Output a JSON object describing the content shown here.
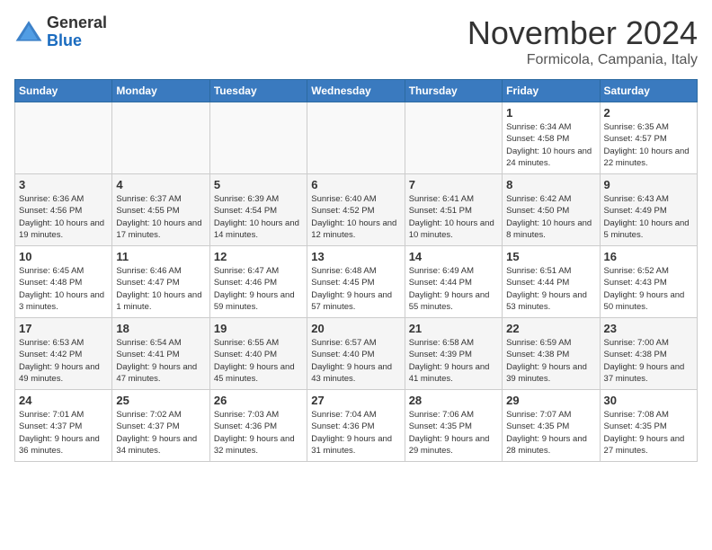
{
  "logo": {
    "general": "General",
    "blue": "Blue"
  },
  "title": "November 2024",
  "location": "Formicola, Campania, Italy",
  "days_of_week": [
    "Sunday",
    "Monday",
    "Tuesday",
    "Wednesday",
    "Thursday",
    "Friday",
    "Saturday"
  ],
  "weeks": [
    [
      {
        "day": "",
        "info": ""
      },
      {
        "day": "",
        "info": ""
      },
      {
        "day": "",
        "info": ""
      },
      {
        "day": "",
        "info": ""
      },
      {
        "day": "",
        "info": ""
      },
      {
        "day": "1",
        "info": "Sunrise: 6:34 AM\nSunset: 4:58 PM\nDaylight: 10 hours and 24 minutes."
      },
      {
        "day": "2",
        "info": "Sunrise: 6:35 AM\nSunset: 4:57 PM\nDaylight: 10 hours and 22 minutes."
      }
    ],
    [
      {
        "day": "3",
        "info": "Sunrise: 6:36 AM\nSunset: 4:56 PM\nDaylight: 10 hours and 19 minutes."
      },
      {
        "day": "4",
        "info": "Sunrise: 6:37 AM\nSunset: 4:55 PM\nDaylight: 10 hours and 17 minutes."
      },
      {
        "day": "5",
        "info": "Sunrise: 6:39 AM\nSunset: 4:54 PM\nDaylight: 10 hours and 14 minutes."
      },
      {
        "day": "6",
        "info": "Sunrise: 6:40 AM\nSunset: 4:52 PM\nDaylight: 10 hours and 12 minutes."
      },
      {
        "day": "7",
        "info": "Sunrise: 6:41 AM\nSunset: 4:51 PM\nDaylight: 10 hours and 10 minutes."
      },
      {
        "day": "8",
        "info": "Sunrise: 6:42 AM\nSunset: 4:50 PM\nDaylight: 10 hours and 8 minutes."
      },
      {
        "day": "9",
        "info": "Sunrise: 6:43 AM\nSunset: 4:49 PM\nDaylight: 10 hours and 5 minutes."
      }
    ],
    [
      {
        "day": "10",
        "info": "Sunrise: 6:45 AM\nSunset: 4:48 PM\nDaylight: 10 hours and 3 minutes."
      },
      {
        "day": "11",
        "info": "Sunrise: 6:46 AM\nSunset: 4:47 PM\nDaylight: 10 hours and 1 minute."
      },
      {
        "day": "12",
        "info": "Sunrise: 6:47 AM\nSunset: 4:46 PM\nDaylight: 9 hours and 59 minutes."
      },
      {
        "day": "13",
        "info": "Sunrise: 6:48 AM\nSunset: 4:45 PM\nDaylight: 9 hours and 57 minutes."
      },
      {
        "day": "14",
        "info": "Sunrise: 6:49 AM\nSunset: 4:44 PM\nDaylight: 9 hours and 55 minutes."
      },
      {
        "day": "15",
        "info": "Sunrise: 6:51 AM\nSunset: 4:44 PM\nDaylight: 9 hours and 53 minutes."
      },
      {
        "day": "16",
        "info": "Sunrise: 6:52 AM\nSunset: 4:43 PM\nDaylight: 9 hours and 50 minutes."
      }
    ],
    [
      {
        "day": "17",
        "info": "Sunrise: 6:53 AM\nSunset: 4:42 PM\nDaylight: 9 hours and 49 minutes."
      },
      {
        "day": "18",
        "info": "Sunrise: 6:54 AM\nSunset: 4:41 PM\nDaylight: 9 hours and 47 minutes."
      },
      {
        "day": "19",
        "info": "Sunrise: 6:55 AM\nSunset: 4:40 PM\nDaylight: 9 hours and 45 minutes."
      },
      {
        "day": "20",
        "info": "Sunrise: 6:57 AM\nSunset: 4:40 PM\nDaylight: 9 hours and 43 minutes."
      },
      {
        "day": "21",
        "info": "Sunrise: 6:58 AM\nSunset: 4:39 PM\nDaylight: 9 hours and 41 minutes."
      },
      {
        "day": "22",
        "info": "Sunrise: 6:59 AM\nSunset: 4:38 PM\nDaylight: 9 hours and 39 minutes."
      },
      {
        "day": "23",
        "info": "Sunrise: 7:00 AM\nSunset: 4:38 PM\nDaylight: 9 hours and 37 minutes."
      }
    ],
    [
      {
        "day": "24",
        "info": "Sunrise: 7:01 AM\nSunset: 4:37 PM\nDaylight: 9 hours and 36 minutes."
      },
      {
        "day": "25",
        "info": "Sunrise: 7:02 AM\nSunset: 4:37 PM\nDaylight: 9 hours and 34 minutes."
      },
      {
        "day": "26",
        "info": "Sunrise: 7:03 AM\nSunset: 4:36 PM\nDaylight: 9 hours and 32 minutes."
      },
      {
        "day": "27",
        "info": "Sunrise: 7:04 AM\nSunset: 4:36 PM\nDaylight: 9 hours and 31 minutes."
      },
      {
        "day": "28",
        "info": "Sunrise: 7:06 AM\nSunset: 4:35 PM\nDaylight: 9 hours and 29 minutes."
      },
      {
        "day": "29",
        "info": "Sunrise: 7:07 AM\nSunset: 4:35 PM\nDaylight: 9 hours and 28 minutes."
      },
      {
        "day": "30",
        "info": "Sunrise: 7:08 AM\nSunset: 4:35 PM\nDaylight: 9 hours and 27 minutes."
      }
    ]
  ]
}
